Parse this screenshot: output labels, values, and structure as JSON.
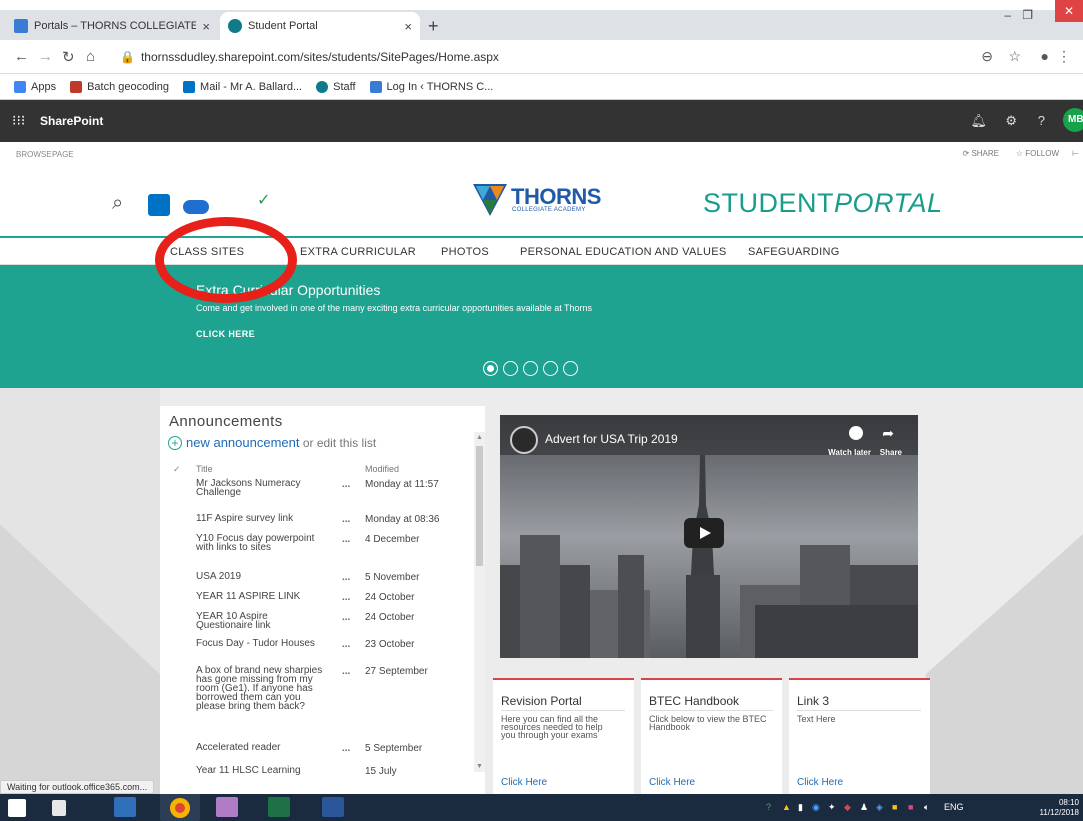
{
  "browser": {
    "tabs": [
      {
        "title": "Portals – THORNS COLLEGIATE A"
      },
      {
        "title": "Student Portal"
      }
    ],
    "close_glyph": "×",
    "newtab_glyph": "+",
    "url": "thornssdudley.sharepoint.com/sites/students/SitePages/Home.aspx",
    "bookmarks": [
      "Apps",
      "Batch geocoding",
      "Mail - Mr A. Ballard...",
      "Staff",
      "Log In ‹ THORNS C..."
    ]
  },
  "sharepoint": {
    "brand": "SharePoint",
    "avatar": "MB",
    "ribbon_left": [
      "BROWSE",
      "PAGE"
    ],
    "ribbon_right": [
      "SHARE",
      "FOLLOW"
    ]
  },
  "header": {
    "logo_name": "THORNS",
    "logo_sub": "COLLEGIATE ACADEMY",
    "portal_a": "STUDENT",
    "portal_b": "PORTAL"
  },
  "nav": [
    "CLASS SITES",
    "EXTRA CURRICULAR",
    "PHOTOS",
    "PERSONAL EDUCATION AND VALUES",
    "SAFEGUARDING"
  ],
  "banner": {
    "heading": "Extra Curricular Opportunities",
    "desc": "Come and get involved in one of the many exciting extra curricular opportunities available at Thorns",
    "cta": "CLICK HERE"
  },
  "announcements": {
    "title": "Announcements",
    "new_link": "new announcement",
    "or_edit": "or edit this list",
    "col_title": "Title",
    "col_modified": "Modified",
    "ellipsis": "...",
    "items": [
      {
        "title": "Mr Jacksons Numeracy Challenge",
        "modified": "Monday at 11:57"
      },
      {
        "title": "11F Aspire survey link",
        "modified": "Monday at 08:36"
      },
      {
        "title": "Y10 Focus day powerpoint with links to sites",
        "modified": "4 December"
      },
      {
        "title": "USA 2019",
        "modified": "5 November"
      },
      {
        "title": "YEAR 11 ASPIRE LINK",
        "modified": "24 October"
      },
      {
        "title": "YEAR 10 Aspire Questionaire link",
        "modified": "24 October"
      },
      {
        "title": "Focus Day - Tudor Houses",
        "modified": "23 October"
      },
      {
        "title": "A box of brand new sharpies has gone missing from my room (Ge1). If anyone has borrowed them can you please bring them back?",
        "modified": "27 September"
      },
      {
        "title": "Accelerated reader",
        "modified": "5 September"
      },
      {
        "title": "Year 11 HLSC Learning",
        "modified": "15 July"
      }
    ]
  },
  "video": {
    "title": "Advert for USA Trip 2019",
    "watch_later": "Watch later",
    "share": "Share"
  },
  "cards": [
    {
      "title": "Revision Portal",
      "desc": "Here you can find all the resources needed to help you through your exams",
      "link": "Click Here"
    },
    {
      "title": "BTEC Handbook",
      "desc": "Click below to view the BTEC Handbook",
      "link": "Click Here"
    },
    {
      "title": "Link 3",
      "desc": "Text Here",
      "link": "Click Here"
    }
  ],
  "status_text": "Waiting for outlook.office365.com...",
  "taskbar": {
    "lang": "ENG",
    "time": "08:10",
    "date": "11/12/2018"
  },
  "colors": {
    "teal": "#1da390",
    "highlight_red": "#e8201a",
    "sharepoint_bar": "#333333",
    "card_border": "#d64545"
  }
}
